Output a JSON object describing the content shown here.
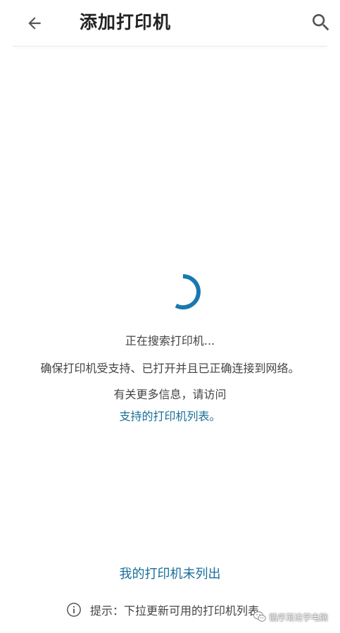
{
  "header": {
    "title": "添加打印机"
  },
  "main": {
    "searching_text": "正在搜索打印机...",
    "ensure_text": "确保打印机受支持、已打开并且已正确连接到网络。",
    "more_info_text": "有关更多信息，请访问",
    "supported_link": "支持的打印机列表。",
    "not_listed_link": "我的打印机未列出",
    "hint_text": "提示：下拉更新可用的打印机列表"
  },
  "watermark": {
    "text": "循序渐进学电脑"
  },
  "colors": {
    "accent": "#1a6f9a",
    "spinner": "#1a78b0",
    "icon_gray": "#555555"
  },
  "icons": {
    "back": "arrow-back-icon",
    "search": "search-icon",
    "info": "info-icon",
    "spinner": "loading-spinner",
    "watermark": "wechat-icon"
  }
}
